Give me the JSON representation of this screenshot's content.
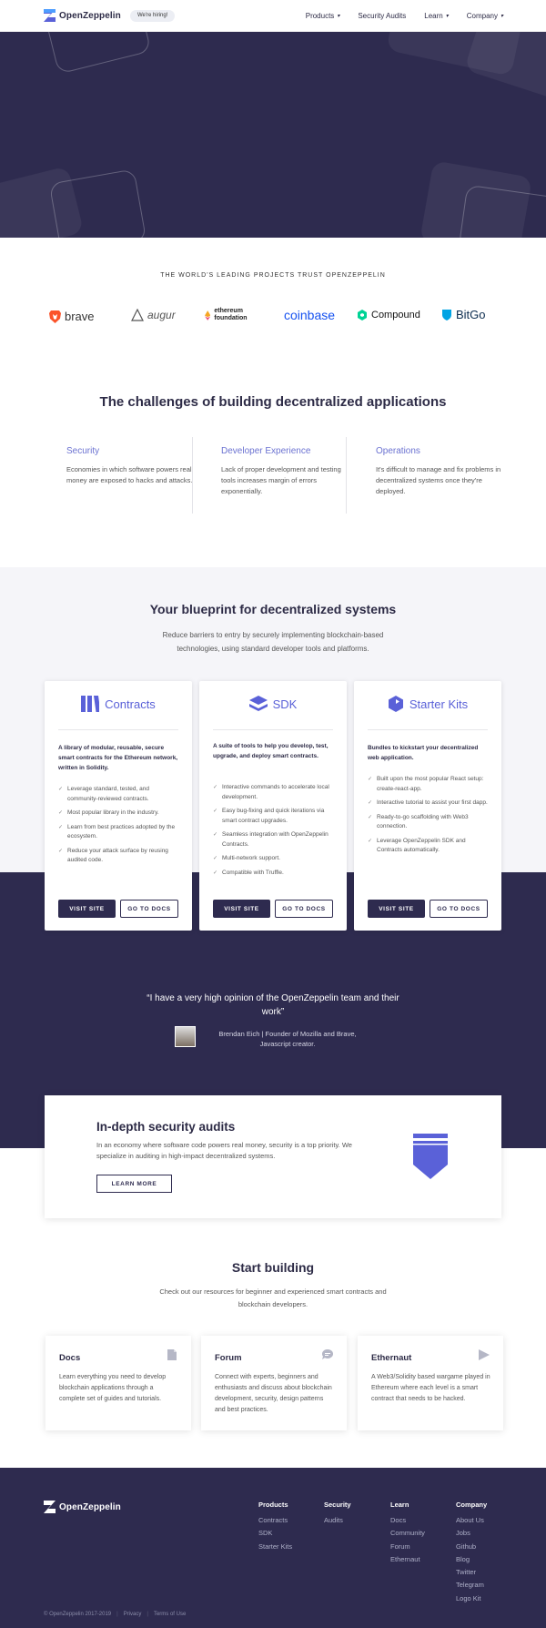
{
  "nav": {
    "brand": "OpenZeppelin",
    "hiring": "We're hiring!",
    "links": [
      "Products",
      "Security Audits",
      "Learn",
      "Company"
    ]
  },
  "trust": {
    "title": "THE WORLD'S LEADING PROJECTS TRUST OPENZEPPELIN",
    "logos": [
      "brave",
      "augur",
      "ethereum foundation",
      "coinbase",
      "Compound",
      "BitGo"
    ]
  },
  "challenges": {
    "title": "The challenges of building decentralized applications",
    "items": [
      {
        "title": "Security",
        "text": "Economies in which software powers real money are exposed to hacks and attacks."
      },
      {
        "title": "Developer Experience",
        "text": "Lack of proper development and testing tools increases margin of errors exponentially."
      },
      {
        "title": "Operations",
        "text": "It's difficult to manage and fix problems in decentralized systems once they're deployed."
      }
    ]
  },
  "blueprint": {
    "title": "Your blueprint for decentralized systems",
    "subtitle": "Reduce barriers to entry by securely implementing blockchain-based technologies, using standard developer tools and platforms.",
    "cards": [
      {
        "title": "Contracts",
        "lead": "A library of modular, reusable, secure smart contracts for the Ethereum network, written in Solidity.",
        "items": [
          "Leverage standard, tested, and community-reviewed contracts.",
          "Most popular library in the industry.",
          "Learn from best practices adopted by the ecosystem.",
          "Reduce your attack surface by reusing audited code."
        ],
        "primary": "VISIT SITE",
        "secondary": "GO TO DOCS"
      },
      {
        "title": "SDK",
        "lead": "A suite of tools to help you develop, test, upgrade, and deploy smart contracts.",
        "items": [
          "Interactive commands to accelerate local development.",
          "Easy bug-fixing and quick iterations via smart contract upgrades.",
          "Seamless integration with OpenZeppelin Contracts.",
          "Multi-network support.",
          "Compatible with Truffle."
        ],
        "primary": "VISIT SITE",
        "secondary": "GO TO DOCS"
      },
      {
        "title": "Starter Kits",
        "lead": "Bundles to kickstart your decentralized web application.",
        "items": [
          "Built upon the most popular React setup: create-react-app.",
          "Interactive tutorial to assist your first dapp.",
          "Ready-to-go scaffolding with Web3 connection.",
          "Leverage OpenZeppelin SDK and Contracts automatically."
        ],
        "primary": "VISIT SITE",
        "secondary": "GO TO DOCS"
      }
    ]
  },
  "quote": {
    "text": "“I have a very high opinion of the OpenZeppelin team and their work”",
    "author": "Brendan Eich | Founder of Mozilla and Brave, Javascript creator."
  },
  "audits": {
    "title": "In-depth security audits",
    "text": "In an economy where software code powers real money, security is a top priority. We specialize in auditing in high-impact decentralized systems.",
    "button": "LEARN MORE"
  },
  "start": {
    "title": "Start building",
    "subtitle": "Check out our resources for beginner and experienced smart contracts and blockchain developers.",
    "cards": [
      {
        "title": "Docs",
        "text": "Learn everything you need to develop blockchain applications through a complete set of guides and tutorials.",
        "icon": "document-icon"
      },
      {
        "title": "Forum",
        "text": "Connect with experts, beginners and enthusiasts and discuss about blockchain development, security, design patterns and best practices.",
        "icon": "chat-icon"
      },
      {
        "title": "Ethernaut",
        "text": "A Web3/Solidity based wargame played in Ethereum where each level is a smart contract that needs to be hacked.",
        "icon": "flag-icon"
      }
    ]
  },
  "footer": {
    "brand": "OpenZeppelin",
    "columns": [
      {
        "title": "Products",
        "links": [
          "Contracts",
          "SDK",
          "Starter Kits"
        ]
      },
      {
        "title": "Security",
        "links": [
          "Audits"
        ]
      },
      {
        "title": "Learn",
        "links": [
          "Docs",
          "Community",
          "Forum",
          "Ethernaut"
        ]
      },
      {
        "title": "Company",
        "links": [
          "About Us",
          "Jobs",
          "Github",
          "Blog",
          "Twitter",
          "Telegram",
          "Logo Kit"
        ]
      }
    ],
    "copyright": "© OpenZeppelin 2017-2019",
    "privacy": "Privacy",
    "terms": "Terms of Use"
  },
  "colors": {
    "navy": "#2e2b4f",
    "accent": "#5a61d8",
    "light_bg": "#f5f5f9"
  }
}
